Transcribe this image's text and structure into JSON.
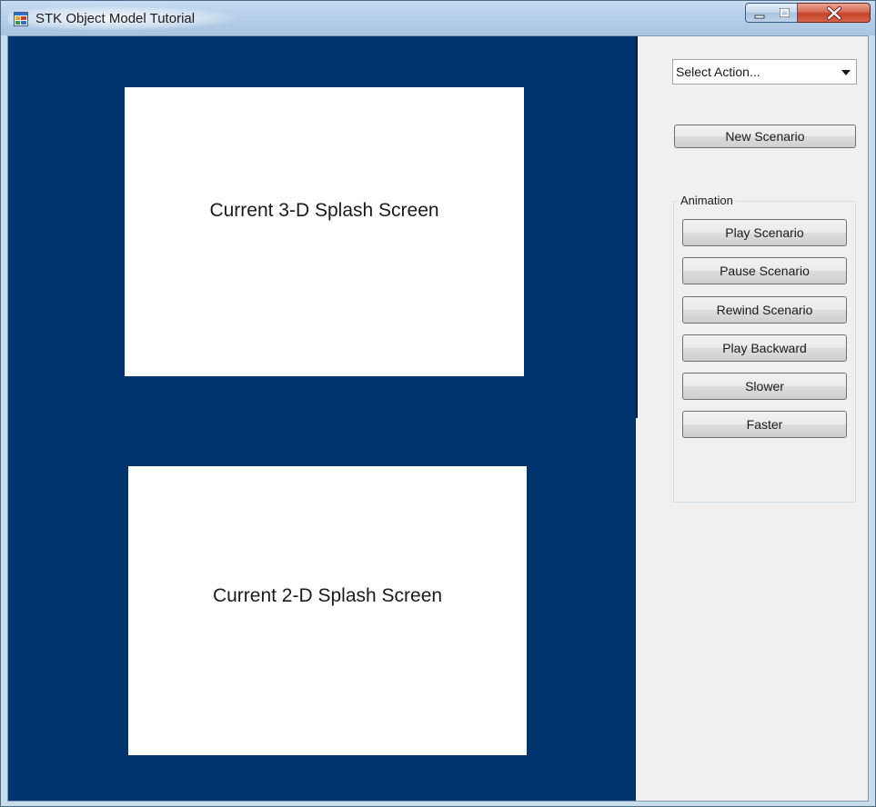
{
  "window": {
    "title": "STK Object Model Tutorial"
  },
  "colors": {
    "viewport_background": "#00346e",
    "splash_background": "#ffffff",
    "panel_background": "#f0f0f0",
    "close_button": "#c7412a"
  },
  "icons": {
    "app": "app-window-icon",
    "minimize": "minimize-icon",
    "maximize": "maximize-icon",
    "close": "close-icon",
    "dropdown": "chevron-down-icon"
  },
  "viewport": {
    "splash_3d": "Current 3-D Splash Screen",
    "splash_2d": "Current 2-D Splash Screen"
  },
  "panel": {
    "action_select": {
      "value": "Select Action..."
    },
    "new_scenario_label": "New Scenario",
    "animation": {
      "legend": "Animation",
      "buttons": [
        "Play Scenario",
        "Pause Scenario",
        "Rewind Scenario",
        "Play Backward",
        "Slower",
        "Faster"
      ]
    }
  }
}
